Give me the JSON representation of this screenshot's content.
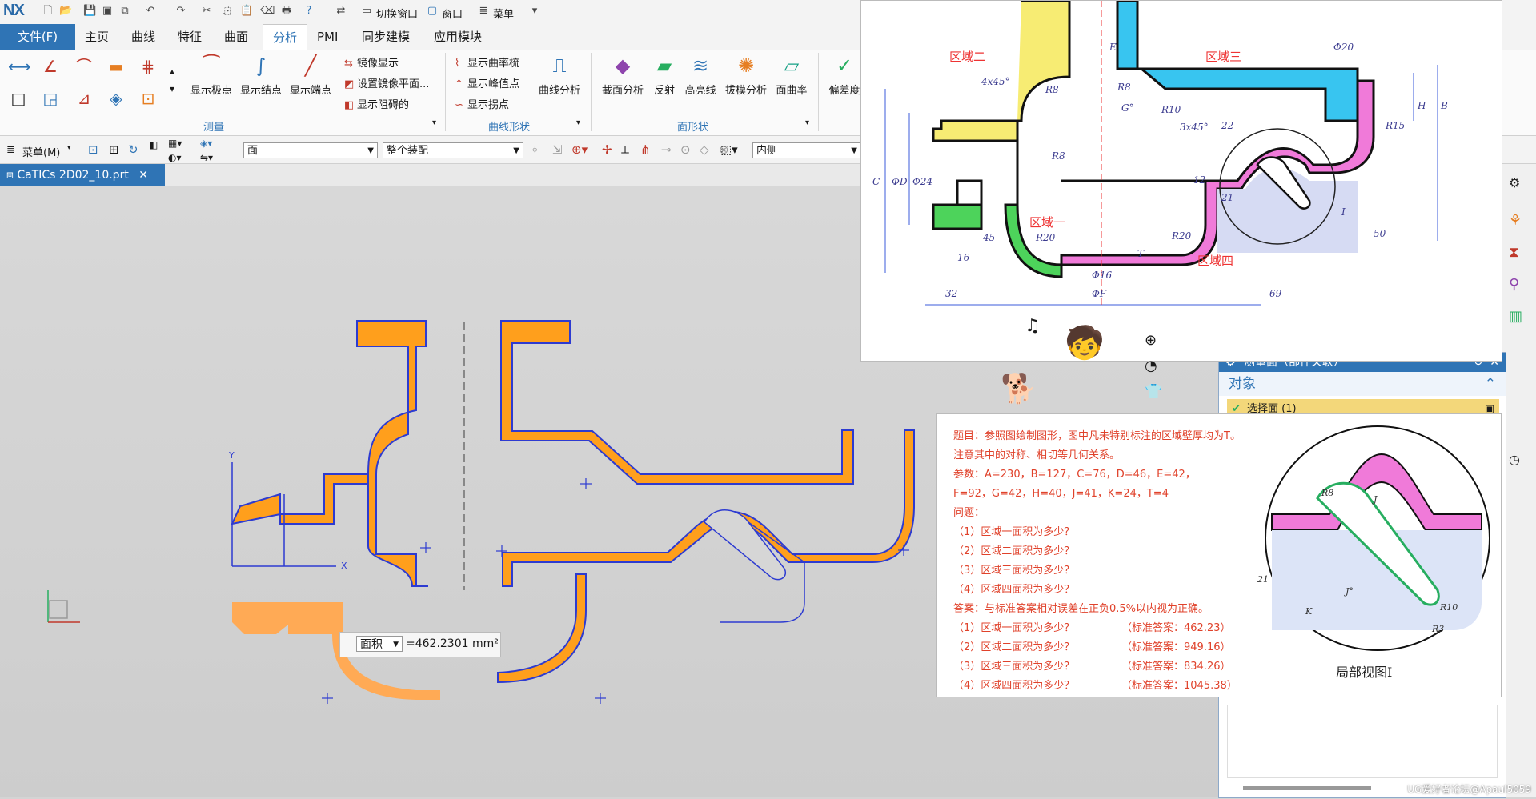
{
  "app": {
    "logo": "NX"
  },
  "quickbar": {
    "switch_window": "切换窗口",
    "window": "窗口",
    "menu": "菜单"
  },
  "tabs": [
    "文件(F)",
    "主页",
    "曲线",
    "特征",
    "曲面",
    "分析",
    "PMI",
    "同步建模",
    "应用模块"
  ],
  "ribbon": {
    "measure": {
      "show_poles": "显示极点",
      "show_knots": "显示结点",
      "show_ends": "显示端点",
      "mirror_display": "镜像显示",
      "set_mirror_plane": "设置镜像平面...",
      "show_block": "显示阻碍的",
      "group": "测量"
    },
    "curve_shape": {
      "curvature_comb": "显示曲率梳",
      "show_peaks": "显示峰值点",
      "show_inflections": "显示拐点",
      "curve_analysis": "曲线分析",
      "group": "曲线形状"
    },
    "face_shape": {
      "section_analysis": "截面分析",
      "reflection": "反射",
      "highlight": "高亮线",
      "draft_analysis": "拔模分析",
      "face_curvature": "面曲率",
      "deviation": "偏差度",
      "group": "面形状"
    }
  },
  "selbar": {
    "menu": "菜单(M)",
    "filter": "面",
    "scope": "整个装配",
    "inner": "内侧"
  },
  "file_tab": "CaTICs 2D02_10.prt",
  "measure_tag": {
    "type": "面积",
    "value": "=462.2301 mm²"
  },
  "dialog": {
    "title": "测量面（部件关联）",
    "section": "对象",
    "select_face": "选择面 (1)"
  },
  "drawing": {
    "regions": [
      "区域一",
      "区域二",
      "区域三",
      "区域四"
    ],
    "dims": [
      "E",
      "Φ20",
      "4x45°",
      "R8",
      "R8",
      "R10",
      "G°",
      "3x45°",
      "22",
      "R15",
      "H",
      "B",
      "C",
      "ΦD",
      "Φ24",
      "R8",
      "12",
      "21",
      "I",
      "R20",
      "R20",
      "45",
      "16",
      "T",
      "Φ16",
      "50",
      "32",
      "ΦF",
      "69"
    ]
  },
  "question": {
    "title": "题目：参照图绘制图形，图中凡未特别标注的区域壁厚均为T。",
    "note": "注意其中的对称、相切等几何关系。",
    "params1": "参数：A=230，B=127，C=76，D=46，E=42，",
    "params2": "F=92，G=42，H=40，J=41，K=24，T=4",
    "problem": "问题：",
    "q": [
      "（1）区域一面积为多少？",
      "（2）区域二面积为多少？",
      "（3）区域三面积为多少？",
      "（4）区域四面积为多少？"
    ],
    "answer_head": "答案：与标准答案相对误差在正负0.5%以内视为正确。",
    "a": [
      "（标准答案：462.23）",
      "（标准答案：949.16）",
      "（标准答案：834.26）",
      "（标准答案：1045.38）"
    ],
    "detail_label": "局部视图I",
    "detail_dims": [
      "R8",
      "J",
      "R10",
      "R3",
      "J°",
      "K",
      "21"
    ]
  },
  "watermark": "UG爱好者论坛@Apaul5059",
  "colors": {
    "accent": "#2f74b5",
    "sketch_fill": "#ff9f1c",
    "edge": "#2d3bd1"
  }
}
